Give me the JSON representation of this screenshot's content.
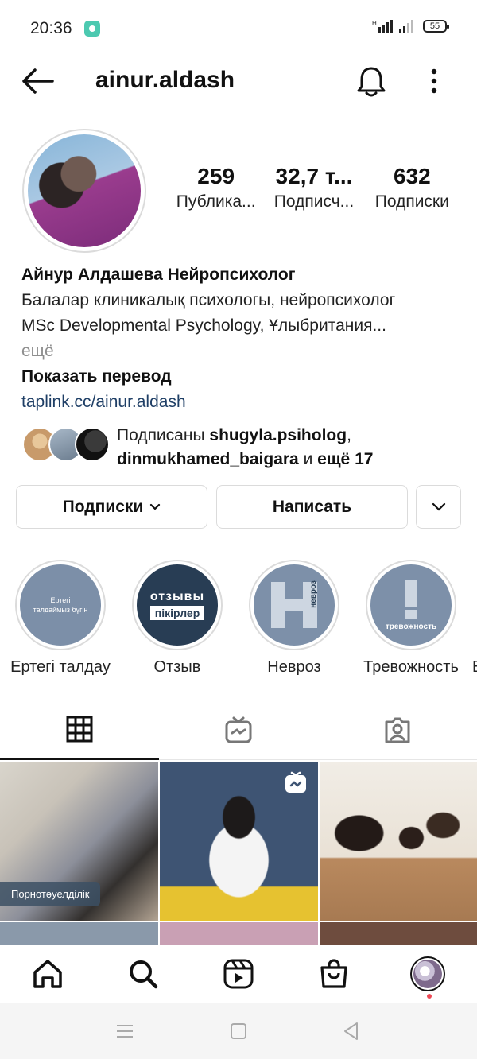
{
  "status": {
    "time": "20:36",
    "battery": "55"
  },
  "header": {
    "username": "ainur.aldash"
  },
  "stats": [
    {
      "num": "259",
      "label": "Публика..."
    },
    {
      "num": "32,7 т...",
      "label": "Подписч..."
    },
    {
      "num": "632",
      "label": "Подписки"
    }
  ],
  "bio": {
    "name": "Айнур Алдашева Нейропсихолог",
    "line1": "Балалар клиникалық психологы, нейропсихолог",
    "line2": "MSc Developmental Psychology, Ұлыбритания...",
    "more": "ещё",
    "translate": "Показать перевод",
    "link": "taplink.cc/ainur.aldash"
  },
  "mutual": {
    "prefix": "Подписаны",
    "user1": "shugyla.psiholog",
    "sep": ",",
    "user2": "dinmukhamed_baigara",
    "and": "и",
    "rest": "ещё 17"
  },
  "actions": {
    "following": "Подписки",
    "message": "Написать"
  },
  "highlights": [
    {
      "label": "Ертегі талдау",
      "cover_text": "Ертегі талдаймыз бүгін"
    },
    {
      "label": "Отзыв",
      "cover_text_1": "отзывы",
      "cover_text_2": "пікірлер"
    },
    {
      "label": "Невроз",
      "cover_text": "невроз"
    },
    {
      "label": "Тревожность",
      "cover_text": "тревожность"
    },
    {
      "label": "В"
    }
  ],
  "grid": {
    "caption": "Порнотәуелділік"
  },
  "colors": {
    "link": "#1f3f66",
    "notification_dot": "#ed4956",
    "highlight_cover": "#7d90a9",
    "highlight_dark": "#283d54"
  }
}
